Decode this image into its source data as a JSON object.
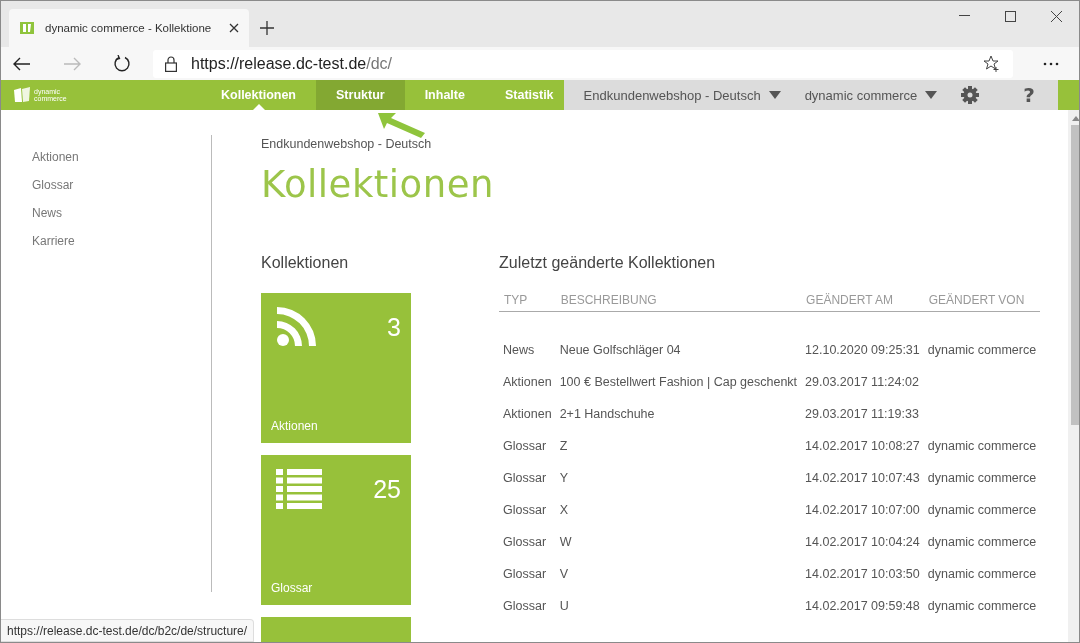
{
  "browser": {
    "tab_title": "dynamic commerce - Kollektione",
    "url_main": "https://release.dc-test.de",
    "url_path": "/dc/",
    "status_url": "https://release.dc-test.de/dc/b2c/de/structure/"
  },
  "nav": {
    "logo_line1": "dynamic",
    "logo_line2": "commerce",
    "items": [
      {
        "label": "Kollektionen",
        "selected": true,
        "highlighted": false
      },
      {
        "label": "Struktur",
        "selected": false,
        "highlighted": true
      },
      {
        "label": "Inhalte",
        "selected": false,
        "highlighted": false
      },
      {
        "label": "Statistik",
        "selected": false,
        "highlighted": false
      }
    ],
    "dropdowns": [
      "Endkundenwebshop - Deutsch",
      "dynamic commerce"
    ],
    "help": "?"
  },
  "sidebar": {
    "items": [
      "Aktionen",
      "Glossar",
      "News",
      "Karriere"
    ]
  },
  "breadcrumb": "Endkundenwebshop - Deutsch",
  "title": "Kollektionen",
  "collections": {
    "heading": "Kollektionen",
    "tiles": [
      {
        "kind": "rss",
        "count": "3",
        "label": "Aktionen"
      },
      {
        "kind": "list",
        "count": "25",
        "label": "Glossar"
      }
    ]
  },
  "recent": {
    "heading": "Zuletzt geänderte Kollektionen",
    "columns": [
      "TYP",
      "BESCHREIBUNG",
      "GEÄNDERT AM",
      "GEÄNDERT VON"
    ],
    "rows": [
      [
        "News",
        "Neue Golfschläger 04",
        "12.10.2020 09:25:31",
        "dynamic commerce"
      ],
      [
        "Aktionen",
        "100 € Bestellwert Fashion | Cap geschenkt",
        "29.03.2017 11:24:02",
        ""
      ],
      [
        "Aktionen",
        "2+1 Handschuhe",
        "29.03.2017 11:19:33",
        ""
      ],
      [
        "Glossar",
        "Z",
        "14.02.2017 10:08:27",
        "dynamic commerce"
      ],
      [
        "Glossar",
        "Y",
        "14.02.2017 10:07:43",
        "dynamic commerce"
      ],
      [
        "Glossar",
        "X",
        "14.02.2017 10:07:00",
        "dynamic commerce"
      ],
      [
        "Glossar",
        "W",
        "14.02.2017 10:04:24",
        "dynamic commerce"
      ],
      [
        "Glossar",
        "V",
        "14.02.2017 10:03:50",
        "dynamic commerce"
      ],
      [
        "Glossar",
        "U",
        "14.02.2017 09:59:48",
        "dynamic commerce"
      ]
    ]
  }
}
